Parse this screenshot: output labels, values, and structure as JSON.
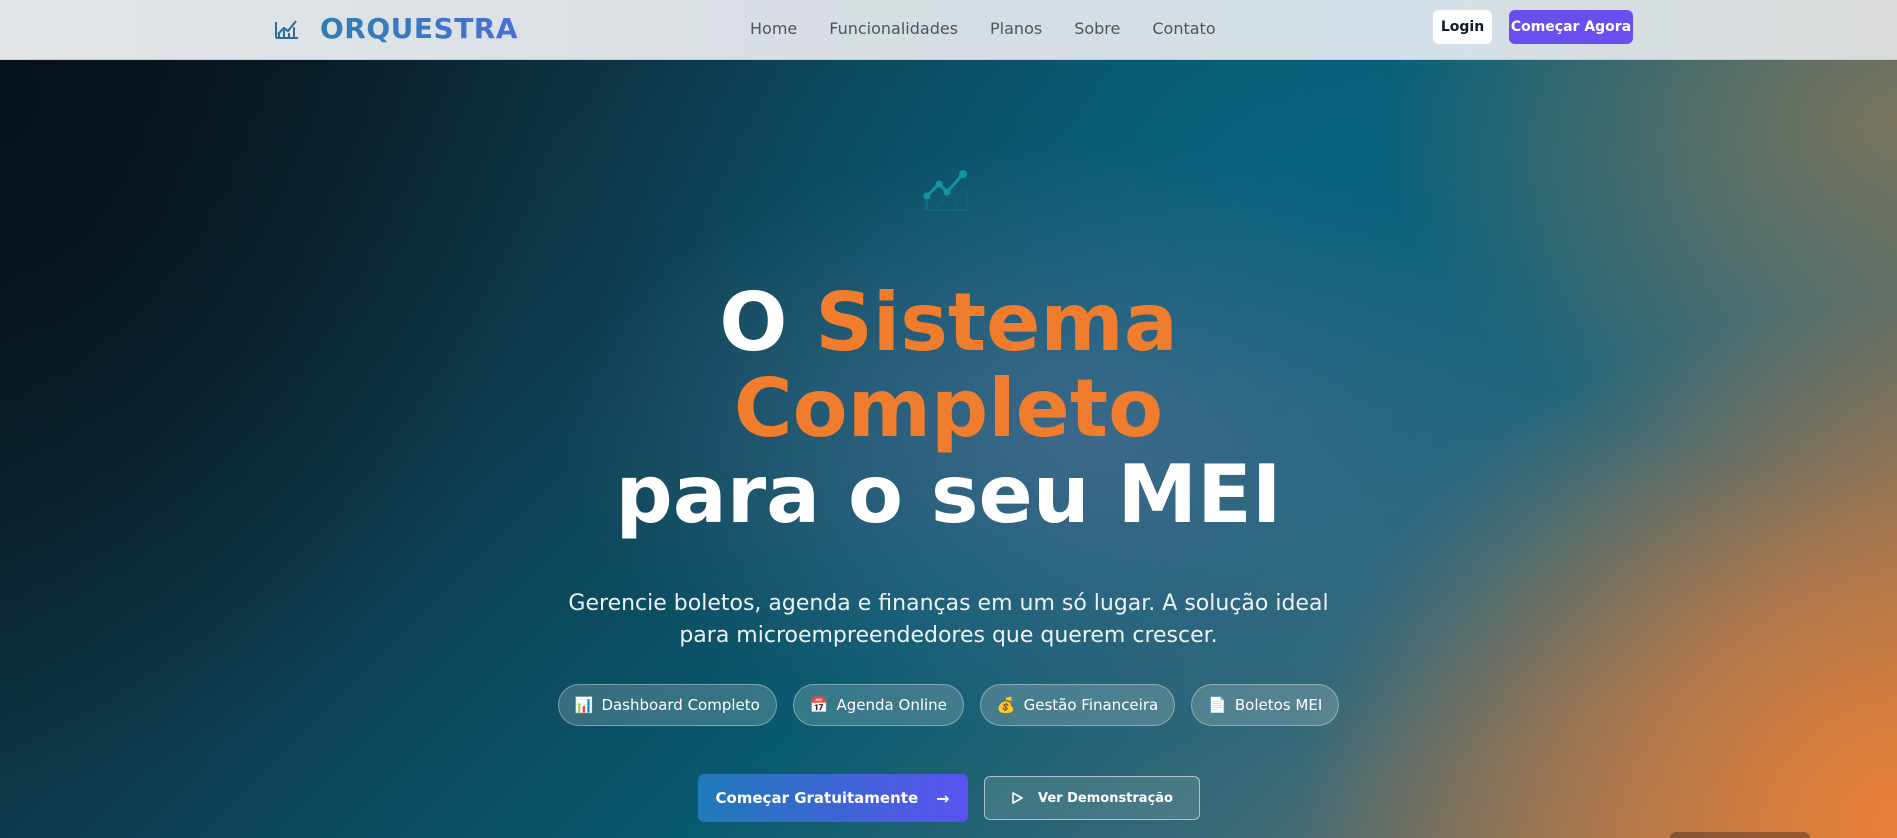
{
  "navbar": {
    "brand": "ORQUESTRA",
    "brand_icon": "chart-line-icon",
    "links": [
      "Home",
      "Funcionalidades",
      "Planos",
      "Sobre",
      "Contato"
    ],
    "login_label": "Login",
    "start_label": "Começar Agora",
    "accent_color": "#6a4ff0"
  },
  "hero": {
    "logo_icon": "chart-growth-dollar-icon",
    "headline": {
      "word1": "O",
      "word2": "Sistema",
      "word3": "Completo",
      "word4": "para o seu MEI"
    },
    "accent_color": "#ef7d2d",
    "subtitle_line1": "Gerencie boletos, agenda e finanças em um só lugar. A solução ideal",
    "subtitle_line2": "para microempreendedores que querem crescer.",
    "pills": [
      {
        "icon": "📊",
        "label": "Dashboard Completo"
      },
      {
        "icon": "📅",
        "label": "Agenda Online"
      },
      {
        "icon": "💰",
        "label": "Gestão Financeira"
      },
      {
        "icon": "📄",
        "label": "Boletos MEI"
      }
    ],
    "cta_primary": "Começar Gratuitamente",
    "cta_secondary": "Ver Demonstração"
  }
}
